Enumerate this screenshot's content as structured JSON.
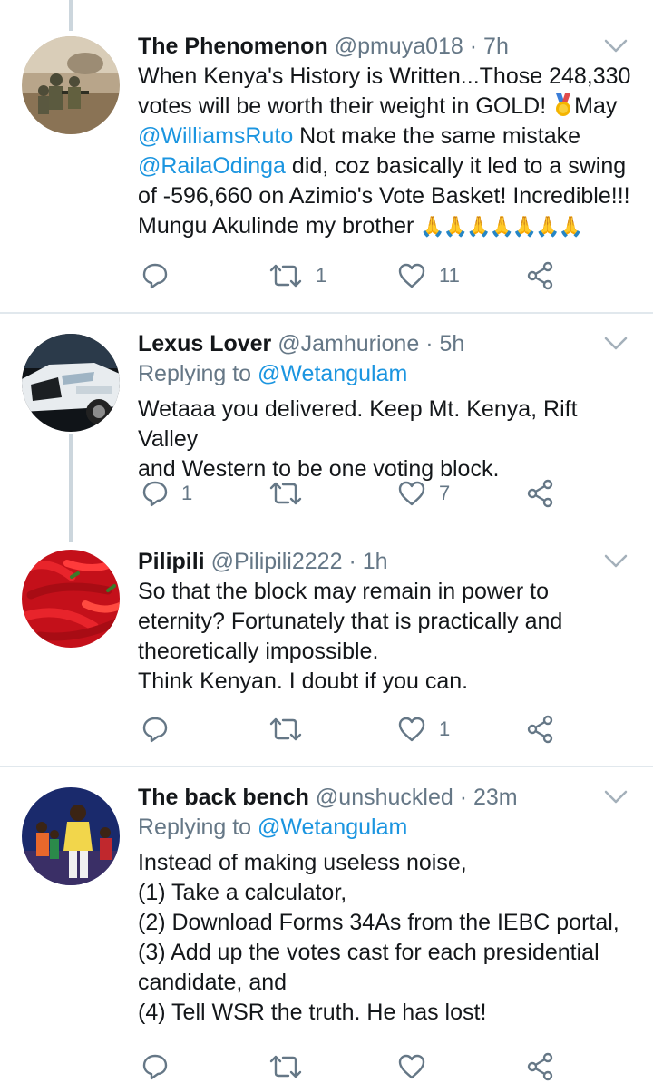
{
  "tweets": [
    {
      "name": "The Phenomenon",
      "handle": "@pmuya018",
      "time": "· 7h",
      "replying_label": "",
      "replying_handle": "",
      "body_parts": {
        "l1": "When Kenya's History is Written...Those 248,330",
        "l2a": "votes will be worth their weight in GOLD! ",
        "l2b": "May",
        "l3a": "@WilliamsRuto",
        "l3b": " Not make the same mistake",
        "l4a": "@RailaOdinga",
        "l4b": " did, coz basically it led to a swing",
        "l5": "of -596,660 on Azimio's Vote Basket! Incredible!!!",
        "l6": "Mungu Akulinde my brother ",
        "emoji_text": "🙏🙏🙏🙏🙏🙏🙏"
      },
      "reply_count": "",
      "retweet_count": "1",
      "like_count": "11"
    },
    {
      "name": "Lexus Lover",
      "handle": "@Jamhurione",
      "time": "· 5h",
      "replying_label": "Replying to ",
      "replying_handle": "@Wetangulam",
      "body": [
        "Wetaaa you delivered. Keep Mt. Kenya, Rift Valley",
        "and Western to be one voting block."
      ],
      "reply_count": "1",
      "retweet_count": "",
      "like_count": "7"
    },
    {
      "name": "Pilipili",
      "handle": "@Pilipili2222",
      "time": "· 1h",
      "body": [
        "So that the block may remain in power to",
        "eternity? Fortunately that is practically and",
        "theoretically impossible.",
        "Think Kenyan. I doubt if you can."
      ],
      "reply_count": "",
      "retweet_count": "",
      "like_count": "1"
    },
    {
      "name": "The back bench",
      "handle": "@unshuckled",
      "time": "· 23m",
      "replying_label": "Replying to ",
      "replying_handle": "@Wetangulam",
      "body": [
        "Instead of making useless noise,",
        "(1) Take a calculator,",
        "(2) Download Forms 34As from the IEBC portal,",
        "(3) Add up the votes cast for each presidential",
        "candidate, and",
        "(4) Tell WSR the truth. He has lost!"
      ]
    }
  ],
  "colors": {
    "link": "#1b95e0",
    "secondary_text": "#657786",
    "primary_text": "#14171a",
    "divider": "#e1e8ed",
    "thread_line": "#ccd6dd"
  },
  "icons": {
    "reply": "reply-icon",
    "retweet": "retweet-icon",
    "like": "heart-icon",
    "share": "share-icon",
    "caret": "chevron-down-icon",
    "medal": "medal-emoji-icon",
    "pray": "folded-hands-emoji"
  }
}
